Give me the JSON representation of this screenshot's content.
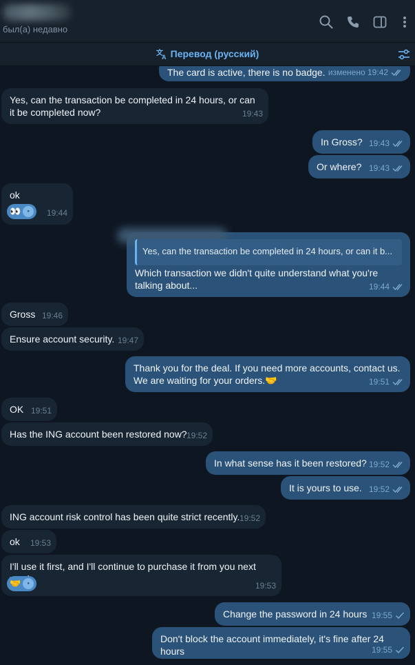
{
  "header": {
    "status": "был(а) недавно",
    "icons": [
      "search-icon",
      "phone-icon",
      "sidebar-icon",
      "more-icon"
    ]
  },
  "translation_bar": {
    "label": "Перевод (русский)"
  },
  "messages": [
    {
      "dir": "out",
      "text": "The card is active, there is no badge.",
      "meta": "изменено 19:42",
      "read": true
    },
    {
      "dir": "in",
      "text": "Yes, can the transaction be completed in 24 hours, or can it be completed now?",
      "time": "19:43"
    },
    {
      "dir": "out",
      "text": "In Gross?",
      "time": "19:43",
      "read": true
    },
    {
      "dir": "out",
      "text": "Or where?",
      "time": "19:43",
      "read": true
    },
    {
      "dir": "in",
      "text": "ok",
      "time": "19:44",
      "reaction": "👀"
    },
    {
      "dir": "out",
      "quote": "Yes, can the transaction be completed in 24 hours, or can it b...",
      "text": "Which transaction we didn't quite understand what you're talking about...",
      "time": "19:44",
      "read": true
    },
    {
      "dir": "in",
      "text": "Gross",
      "time": "19:46"
    },
    {
      "dir": "in",
      "text": "Ensure account security.",
      "time": "19:47"
    },
    {
      "dir": "out",
      "text": "Thank you for the deal. If you need more accounts, contact us. We are waiting for your orders.🤝",
      "time": "19:51",
      "read": true
    },
    {
      "dir": "in",
      "text": "OK",
      "time": "19:51"
    },
    {
      "dir": "in",
      "text": "Has the ING account been restored now?",
      "time": "19:52"
    },
    {
      "dir": "out",
      "text": "In what sense has it been restored?",
      "time": "19:52",
      "read": true
    },
    {
      "dir": "out",
      "text": "It is yours to use.",
      "time": "19:52",
      "read": true
    },
    {
      "dir": "in",
      "text": "ING account risk control has been quite strict recently.",
      "time": "19:52"
    },
    {
      "dir": "in",
      "text": "ok",
      "time": "19:53"
    },
    {
      "dir": "in",
      "text": "I'll use it first, and I'll continue to purchase it from you next week.",
      "time": "19:53",
      "reaction": "🤝"
    },
    {
      "dir": "out",
      "text": "Change the password in 24 hours",
      "time": "19:55",
      "read": false
    },
    {
      "dir": "out",
      "text": "Don't block the account immediately, it's fine after 24 hours",
      "time": "19:55",
      "read": false
    }
  ],
  "colors": {
    "background": "#0e1621",
    "header": "#17212b",
    "incoming": "#182533",
    "outgoing": "#2b5278",
    "accent": "#6ab3f3"
  }
}
